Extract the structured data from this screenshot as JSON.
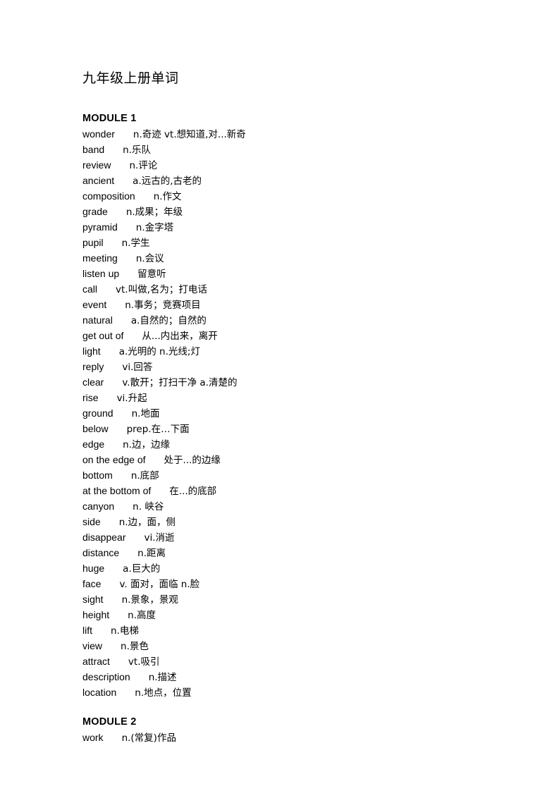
{
  "document": {
    "title": "九年级上册单词"
  },
  "modules": [
    {
      "heading": "MODULE 1",
      "entries": [
        {
          "word": "wonder",
          "gap": "m",
          "definition": "n.奇迹 vt.想知道,对...新奇"
        },
        {
          "word": "band",
          "gap": "m",
          "definition": "n.乐队"
        },
        {
          "word": "review",
          "gap": "m",
          "definition": "n.评论"
        },
        {
          "word": "ancient",
          "gap": "m",
          "definition": "a.远古的,古老的"
        },
        {
          "word": "composition",
          "gap": "m",
          "definition": "n.作文"
        },
        {
          "word": "grade",
          "gap": "m",
          "definition": "n.成果；年级"
        },
        {
          "word": "pyramid",
          "gap": "m",
          "definition": "n.金字塔"
        },
        {
          "word": "pupil",
          "gap": "m",
          "definition": "n.学生"
        },
        {
          "word": "meeting",
          "gap": "m",
          "definition": "n.会议"
        },
        {
          "word": "listen up",
          "gap": "m",
          "definition": "留意听"
        },
        {
          "word": "call",
          "gap": "m",
          "definition": "vt.叫做,名为；打电话"
        },
        {
          "word": "event",
          "gap": "m",
          "definition": "n.事务；竞赛项目"
        },
        {
          "word": "natural",
          "gap": "m",
          "definition": "a.自然的；自然的"
        },
        {
          "word": "get out of",
          "gap": "m",
          "definition": "从...内出来，离开"
        },
        {
          "word": "light",
          "gap": "m",
          "definition": "a.光明的 n.光线;灯"
        },
        {
          "word": "reply",
          "gap": "m",
          "definition": "vi.回答"
        },
        {
          "word": "clear",
          "gap": "m",
          "definition": "v.散开；打扫干净 a.清楚的"
        },
        {
          "word": "rise",
          "gap": "m",
          "definition": "vi.升起"
        },
        {
          "word": "ground",
          "gap": "m",
          "definition": "n.地面"
        },
        {
          "word": "below",
          "gap": "m",
          "definition": "prep.在…下面"
        },
        {
          "word": "edge",
          "gap": "m",
          "definition": "n.边，边缘"
        },
        {
          "word": "on the edge of",
          "gap": "m",
          "definition": "处于...的边缘"
        },
        {
          "word": "bottom",
          "gap": "m",
          "definition": "n.底部"
        },
        {
          "word": "at the bottom of",
          "gap": "m",
          "definition": "在...的底部"
        },
        {
          "word": "canyon",
          "gap": "m",
          "definition": "n. 峡谷"
        },
        {
          "word": "side",
          "gap": "m",
          "definition": "n.边，面，侧"
        },
        {
          "word": "disappear",
          "gap": "m",
          "definition": "vi.消逝"
        },
        {
          "word": "distance",
          "gap": "m",
          "definition": "n.距离"
        },
        {
          "word": "huge",
          "gap": "m",
          "definition": "a.巨大的"
        },
        {
          "word": "face",
          "gap": "m",
          "definition": "v. 面对，面临 n.脸"
        },
        {
          "word": "sight",
          "gap": "m",
          "definition": "n.景象，景观"
        },
        {
          "word": "height",
          "gap": "m",
          "definition": "n.高度"
        },
        {
          "word": "lift",
          "gap": "m",
          "definition": "n.电梯"
        },
        {
          "word": "view",
          "gap": "m",
          "definition": "n.景色"
        },
        {
          "word": "attract",
          "gap": "m",
          "definition": "vt.吸引"
        },
        {
          "word": "description",
          "gap": "m",
          "definition": "n.描述"
        },
        {
          "word": "location",
          "gap": "m",
          "definition": "n.地点，位置"
        }
      ]
    },
    {
      "heading": "MODULE 2",
      "entries": [
        {
          "word": "work",
          "gap": "m",
          "definition": "n.(常复)作品"
        }
      ]
    }
  ]
}
